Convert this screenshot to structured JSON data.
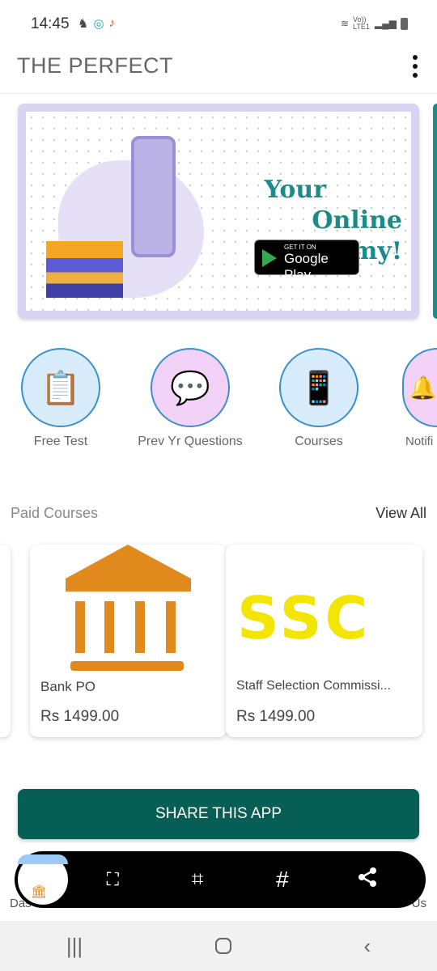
{
  "status_bar": {
    "time": "14:45",
    "network": "Vo)) LTE1"
  },
  "app_bar": {
    "title": "THE PERFECT",
    "menu_icon": "more-vert-icon"
  },
  "banner": {
    "headline_line1": "Your",
    "headline_line2": "Online Academy!",
    "badge_small": "GET IT ON",
    "badge_large": "Google Play"
  },
  "categories": [
    {
      "label": "Free Test",
      "icon": "test-clipboard-icon"
    },
    {
      "label": "Prev Yr Questions",
      "icon": "question-chat-icon"
    },
    {
      "label": "Courses",
      "icon": "book-phone-icon"
    },
    {
      "label": "Notifi",
      "icon": "bell-icon"
    }
  ],
  "paid_courses": {
    "title": "Paid Courses",
    "view_all": "View All",
    "items": [
      {
        "name": "Bank PO",
        "price": "Rs 1499.00",
        "logo": "bank-icon"
      },
      {
        "name": "Staff Selection Commissi...",
        "price": "Rs 1499.00",
        "logo": "SSC"
      }
    ]
  },
  "share_button": "SHARE THIS APP",
  "bottom_fragments": {
    "left": "Das",
    "right": "Us"
  },
  "screenshot_toolbar": {
    "tools": [
      "scroll-capture-icon",
      "crop-edit-icon",
      "hashtag-icon",
      "share-icon"
    ],
    "hashtag": "#"
  },
  "colors": {
    "accent": "#075e54",
    "banner_text": "#1b8a8a",
    "ssc": "#f2e600",
    "bank": "#e08a1e"
  }
}
